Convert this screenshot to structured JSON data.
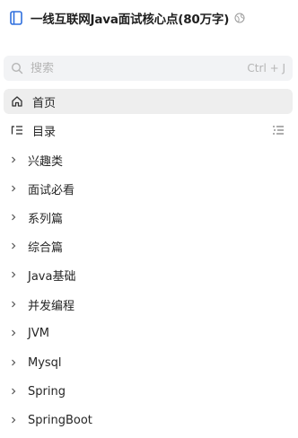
{
  "header": {
    "title": "一线互联网Java面试核心点(80万字)"
  },
  "search": {
    "placeholder": "搜索",
    "shortcut": "Ctrl + J"
  },
  "nav": {
    "home_label": "首页",
    "toc_label": "目录"
  },
  "tree": [
    "兴趣类",
    "面试必看",
    "系列篇",
    "综合篇",
    "Java基础",
    "并发编程",
    "JVM",
    "Mysql",
    "Spring",
    "SpringBoot"
  ],
  "colors": {
    "active_bg": "#eeeeee",
    "search_bg": "#f2f3f5",
    "muted": "#b5b5b5",
    "book_icon": "#2f6fde"
  }
}
